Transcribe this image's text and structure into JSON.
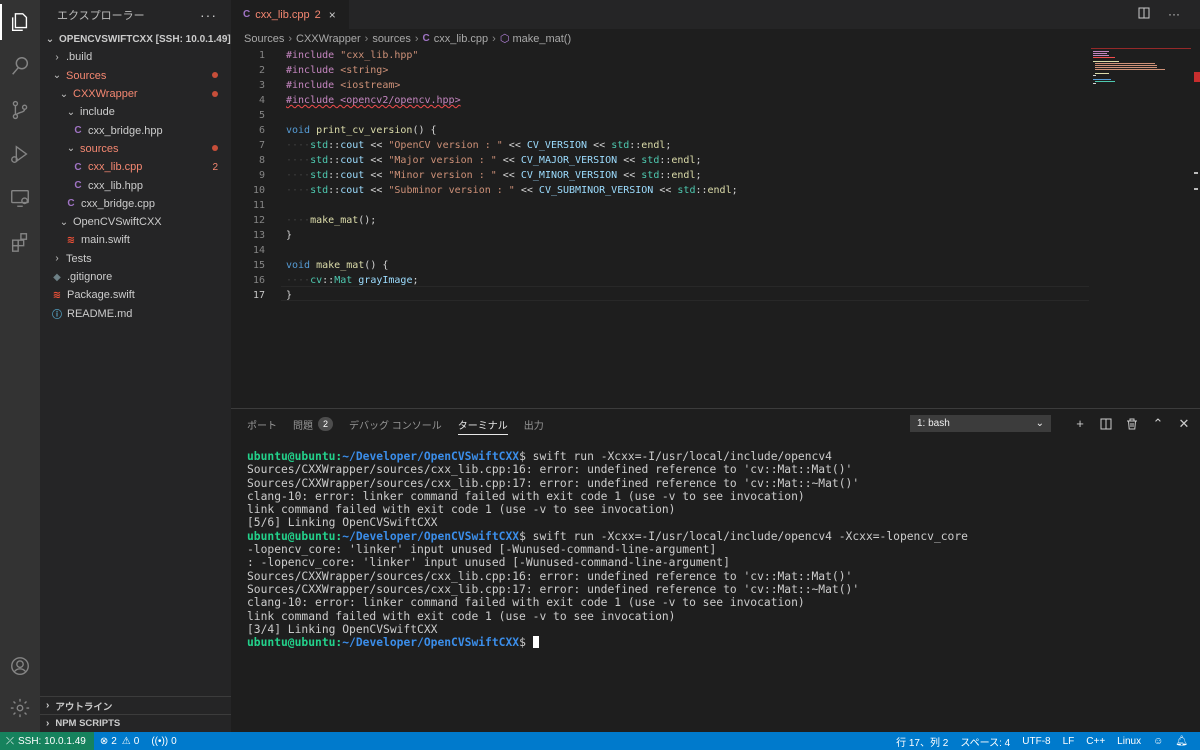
{
  "activity_bar": {
    "items": [
      "explorer-icon",
      "search-icon",
      "source-control-icon",
      "run-debug-icon",
      "remote-explorer-icon",
      "extensions-icon"
    ],
    "bottom": [
      "account-icon",
      "settings-gear-icon"
    ]
  },
  "sidebar": {
    "title": "エクスプローラー",
    "more": "···",
    "root": "OPENCVSWIFTCXX [SSH: 10.0.1.49]",
    "tree": [
      {
        "label": ".build",
        "chev": "›",
        "icon": "",
        "depth": 1,
        "state": "normal"
      },
      {
        "label": "Sources",
        "chev": "⌄",
        "icon": "",
        "depth": 1,
        "state": "error",
        "mark": "dot"
      },
      {
        "label": "CXXWrapper",
        "chev": "⌄",
        "icon": "",
        "depth": 2,
        "state": "error",
        "mark": "dot"
      },
      {
        "label": "include",
        "chev": "⌄",
        "icon": "",
        "depth": 3,
        "state": "normal"
      },
      {
        "label": "cxx_bridge.hpp",
        "chev": "",
        "icon": "C",
        "depth": 4,
        "state": "normal"
      },
      {
        "label": "sources",
        "chev": "⌄",
        "icon": "",
        "depth": 3,
        "state": "error",
        "mark": "dot"
      },
      {
        "label": "cxx_lib.cpp",
        "chev": "",
        "icon": "C",
        "depth": 4,
        "state": "error",
        "mark": "2"
      },
      {
        "label": "cxx_lib.hpp",
        "chev": "",
        "icon": "C",
        "depth": 4,
        "state": "normal"
      },
      {
        "label": "cxx_bridge.cpp",
        "chev": "",
        "icon": "C",
        "depth": 3,
        "state": "normal"
      },
      {
        "label": "OpenCVSwiftCXX",
        "chev": "⌄",
        "icon": "",
        "depth": 2,
        "state": "normal"
      },
      {
        "label": "main.swift",
        "chev": "",
        "icon": "swift",
        "depth": 3,
        "state": "normal"
      },
      {
        "label": "Tests",
        "chev": "›",
        "icon": "",
        "depth": 1,
        "state": "normal"
      },
      {
        "label": ".gitignore",
        "chev": "",
        "icon": "git",
        "depth": 1,
        "state": "normal"
      },
      {
        "label": "Package.swift",
        "chev": "",
        "icon": "swift",
        "depth": 1,
        "state": "normal"
      },
      {
        "label": "README.md",
        "chev": "",
        "icon": "info",
        "depth": 1,
        "state": "normal"
      }
    ],
    "outline": "アウトライン",
    "npm": "NPM SCRIPTS"
  },
  "tab": {
    "icon": "C",
    "label": "cxx_lib.cpp",
    "count": "2",
    "close": "×"
  },
  "breadcrumb": [
    "Sources",
    "CXXWrapper",
    "sources",
    "cxx_lib.cpp",
    "make_mat()"
  ],
  "editor": {
    "lines": [
      "1",
      "2",
      "3",
      "4",
      "5",
      "6",
      "7",
      "8",
      "9",
      "10",
      "11",
      "12",
      "13",
      "14",
      "15",
      "16",
      "17"
    ],
    "code": {
      "l1a": "#include ",
      "l1b": "\"cxx_lib.hpp\"",
      "l2a": "#include ",
      "l2b": "<string>",
      "l3a": "#include ",
      "l3b": "<iostream>",
      "l4": "#include <opencv2/opencv.hpp>",
      "l6a": "void",
      "l6b": "print_cv_version",
      "l6c": "() {",
      "l7s": "\"OpenCV version : \"",
      "l7v": "CV_VERSION",
      "l8s": "\"Major version : \"",
      "l8v": "CV_MAJOR_VERSION",
      "l9s": "\"Minor version : \"",
      "l9v": "CV_MINOR_VERSION",
      "l10s": "\"Subminor version : \"",
      "l10v": "CV_SUBMINOR_VERSION",
      "std": "std",
      "cout": "cout",
      "endl": "endl",
      "l12": "make_mat",
      "l14": "}",
      "l16a": "void",
      "l16b": "make_mat",
      "l16c": "() {",
      "l17a": "cv",
      "l17b": "Mat",
      "l17c": "grayImage",
      "l18": "}"
    }
  },
  "panel": {
    "tabs": [
      "ポート",
      "問題",
      "デバッグ コンソール",
      "ターミナル",
      "出力"
    ],
    "problems_count": "2",
    "terminal_select": "1: bash",
    "terminal_lines": [
      {
        "user": "ubuntu@ubuntu",
        "path": "~/Developer/OpenCVSwiftCXX",
        "cmd": "$ swift run -Xcxx=-I/usr/local/include/opencv4"
      },
      {
        "text": "Sources/CXXWrapper/sources/cxx_lib.cpp:16: error: undefined reference to 'cv::Mat::Mat()'"
      },
      {
        "text": "Sources/CXXWrapper/sources/cxx_lib.cpp:17: error: undefined reference to 'cv::Mat::~Mat()'"
      },
      {
        "text": "clang-10: error: linker command failed with exit code 1 (use -v to see invocation)"
      },
      {
        "text": "link command failed with exit code 1 (use -v to see invocation)"
      },
      {
        "text": "[5/6] Linking OpenCVSwiftCXX"
      },
      {
        "user": "ubuntu@ubuntu",
        "path": "~/Developer/OpenCVSwiftCXX",
        "cmd": "$ swift run -Xcxx=-I/usr/local/include/opencv4 -Xcxx=-lopencv_core"
      },
      {
        "text": "-lopencv_core: 'linker' input unused [-Wunused-command-line-argument]"
      },
      {
        "text": ": -lopencv_core: 'linker' input unused [-Wunused-command-line-argument]"
      },
      {
        "text": "Sources/CXXWrapper/sources/cxx_lib.cpp:16: error: undefined reference to 'cv::Mat::Mat()'"
      },
      {
        "text": "Sources/CXXWrapper/sources/cxx_lib.cpp:17: error: undefined reference to 'cv::Mat::~Mat()'"
      },
      {
        "text": "clang-10: error: linker command failed with exit code 1 (use -v to see invocation)"
      },
      {
        "text": "link command failed with exit code 1 (use -v to see invocation)"
      },
      {
        "text": "[3/4] Linking OpenCVSwiftCXX"
      },
      {
        "user": "ubuntu@ubuntu",
        "path": "~/Developer/OpenCVSwiftCXX",
        "cmd": "$ ",
        "cursor": true
      }
    ]
  },
  "status": {
    "remote": "SSH: 10.0.1.49",
    "errors": "2",
    "warnings": "0",
    "ports": "0",
    "position": "行 17、列 2",
    "spaces": "スペース: 4",
    "encoding": "UTF-8",
    "eol": "LF",
    "language": "C++",
    "os": "Linux"
  },
  "colors": {
    "accent": "#007acc",
    "remote": "#16825d",
    "error": "#f48771",
    "prompt_user": "#23d18b",
    "prompt_path": "#3b8eea"
  }
}
